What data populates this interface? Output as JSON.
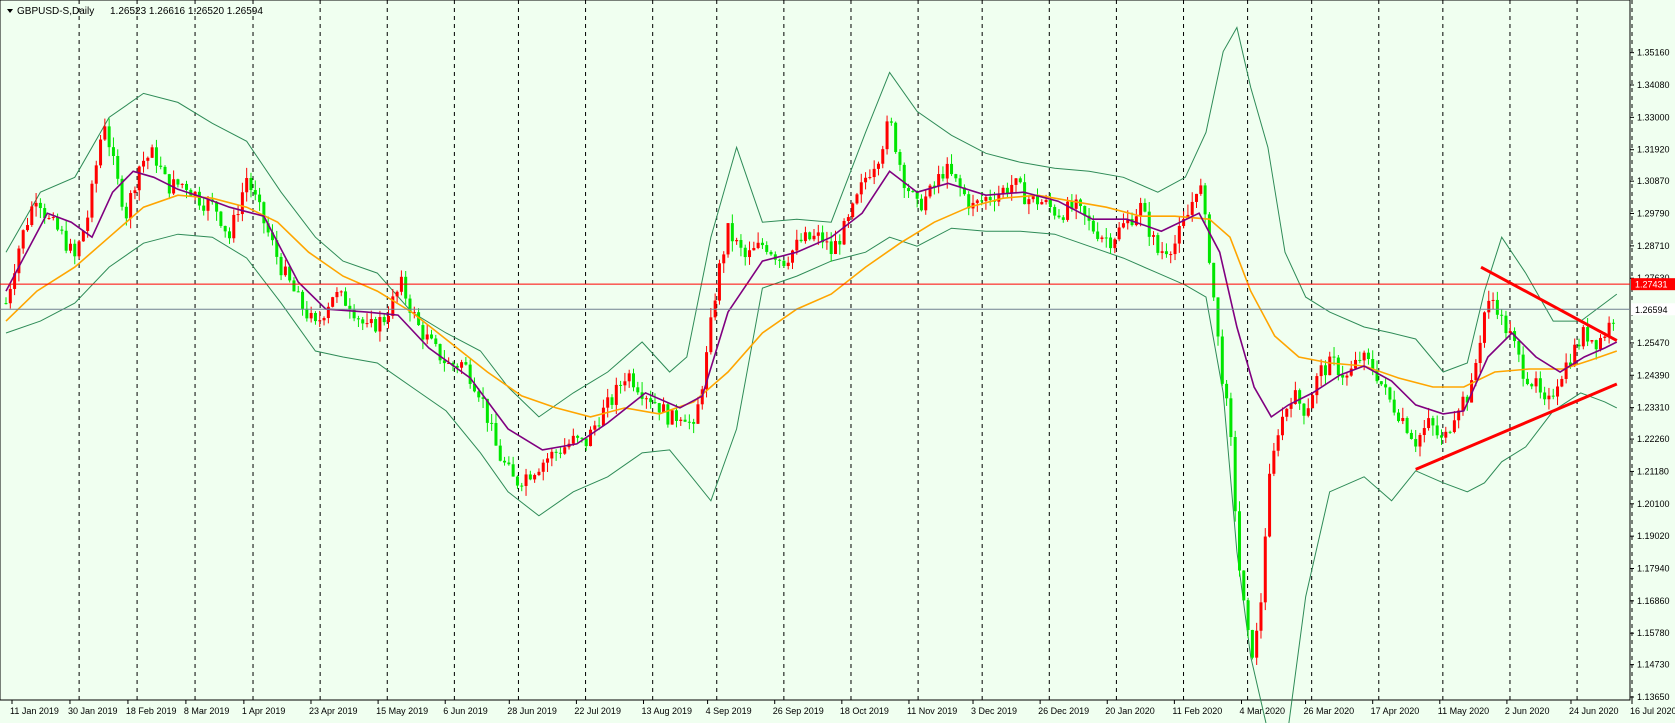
{
  "header": {
    "symbol": "GBPUSD-S,Daily",
    "ohlc": "1.26523 1.26616 1.26520 1.26594"
  },
  "colors": {
    "background": "#f0fff0",
    "bull": "#ff0000",
    "bear": "#00e600",
    "bollinger": "#2e8b57",
    "ma_fast": "#800080",
    "ma_slow": "#ffa500",
    "resistance_line": "#ff0000",
    "price_line": "#708090",
    "trendline": "#ff0000"
  },
  "chart_data": {
    "type": "candlestick",
    "ylim": [
      1.1365,
      1.3625
    ],
    "y_ticks": [
      "1.35160",
      "1.34080",
      "1.33000",
      "1.31920",
      "1.30870",
      "1.29790",
      "1.28710",
      "1.27630",
      "1.25470",
      "1.24390",
      "1.23310",
      "1.22260",
      "1.21180",
      "1.20100",
      "1.19020",
      "1.17940",
      "1.16860",
      "1.15780",
      "1.14730",
      "1.13650"
    ],
    "x_labels": [
      "11 Jan 2019",
      "30 Jan 2019",
      "18 Feb 2019",
      "8 Mar 2019",
      "1 Apr 2019",
      "23 Apr 2019",
      "15 May 2019",
      "6 Jun 2019",
      "28 Jun 2019",
      "22 Jul 2019",
      "13 Aug 2019",
      "4 Sep 2019",
      "26 Sep 2019",
      "18 Oct 2019",
      "11 Nov 2019",
      "3 Dec 2019",
      "26 Dec 2019",
      "20 Jan 2020",
      "11 Feb 2020",
      "4 Mar 2020",
      "26 Mar 2020",
      "17 Apr 2020",
      "11 May 2020",
      "2 Jun 2020",
      "24 Jun 2020",
      "16 Jul 2020"
    ],
    "horizontal_line": {
      "value": 1.27431,
      "label": "1.27431"
    },
    "current_price": {
      "value": 1.26594,
      "label": "1.26594"
    },
    "close_path": [
      [
        0,
        1.268
      ],
      [
        8,
        1.288
      ],
      [
        18,
        1.305
      ],
      [
        24,
        1.296
      ],
      [
        32,
        1.291
      ],
      [
        40,
        1.283
      ],
      [
        48,
        1.298
      ],
      [
        57,
        1.33
      ],
      [
        64,
        1.31
      ],
      [
        70,
        1.298
      ],
      [
        78,
        1.315
      ],
      [
        86,
        1.318
      ],
      [
        94,
        1.307
      ],
      [
        104,
        1.308
      ],
      [
        114,
        1.302
      ],
      [
        122,
        1.3
      ],
      [
        130,
        1.29
      ],
      [
        140,
        1.31
      ],
      [
        150,
        1.295
      ],
      [
        160,
        1.28
      ],
      [
        170,
        1.269
      ],
      [
        180,
        1.26
      ],
      [
        190,
        1.271
      ],
      [
        200,
        1.268
      ],
      [
        210,
        1.259
      ],
      [
        220,
        1.263
      ],
      [
        230,
        1.274
      ],
      [
        240,
        1.26
      ],
      [
        250,
        1.252
      ],
      [
        258,
        1.247
      ],
      [
        266,
        1.248
      ],
      [
        276,
        1.238
      ],
      [
        286,
        1.218
      ],
      [
        296,
        1.208
      ],
      [
        306,
        1.212
      ],
      [
        314,
        1.216
      ],
      [
        322,
        1.219
      ],
      [
        330,
        1.222
      ],
      [
        337,
        1.221
      ],
      [
        345,
        1.23
      ],
      [
        353,
        1.236
      ],
      [
        361,
        1.245
      ],
      [
        370,
        1.239
      ],
      [
        378,
        1.235
      ],
      [
        387,
        1.229
      ],
      [
        394,
        1.232
      ],
      [
        400,
        1.225
      ],
      [
        407,
        1.248
      ],
      [
        414,
        1.277
      ],
      [
        420,
        1.292
      ],
      [
        430,
        1.283
      ],
      [
        441,
        1.288
      ],
      [
        452,
        1.282
      ],
      [
        463,
        1.289
      ],
      [
        474,
        1.29
      ],
      [
        480,
        1.285
      ],
      [
        490,
        1.295
      ],
      [
        500,
        1.31
      ],
      [
        508,
        1.318
      ],
      [
        514,
        1.329
      ],
      [
        522,
        1.31
      ],
      [
        530,
        1.3
      ],
      [
        538,
        1.305
      ],
      [
        546,
        1.313
      ],
      [
        554,
        1.307
      ],
      [
        562,
        1.3
      ],
      [
        570,
        1.303
      ],
      [
        578,
        1.305
      ],
      [
        586,
        1.308
      ],
      [
        594,
        1.303
      ],
      [
        602,
        1.302
      ],
      [
        612,
        1.298
      ],
      [
        622,
        1.3
      ],
      [
        632,
        1.293
      ],
      [
        642,
        1.289
      ],
      [
        652,
        1.295
      ],
      [
        660,
        1.3
      ],
      [
        670,
        1.285
      ],
      [
        680,
        1.288
      ],
      [
        688,
        1.298
      ],
      [
        694,
        1.31
      ],
      [
        700,
        1.284
      ],
      [
        706,
        1.25
      ],
      [
        712,
        1.225
      ],
      [
        718,
        1.175
      ],
      [
        724,
        1.15
      ],
      [
        729,
        1.16
      ],
      [
        734,
        1.205
      ],
      [
        740,
        1.226
      ],
      [
        748,
        1.238
      ],
      [
        756,
        1.232
      ],
      [
        764,
        1.245
      ],
      [
        772,
        1.248
      ],
      [
        780,
        1.243
      ],
      [
        788,
        1.25
      ],
      [
        796,
        1.246
      ],
      [
        804,
        1.236
      ],
      [
        812,
        1.23
      ],
      [
        820,
        1.222
      ],
      [
        828,
        1.228
      ],
      [
        836,
        1.221
      ],
      [
        844,
        1.234
      ],
      [
        852,
        1.238
      ],
      [
        860,
        1.265
      ],
      [
        866,
        1.27
      ],
      [
        870,
        1.262
      ],
      [
        876,
        1.256
      ],
      [
        882,
        1.246
      ],
      [
        890,
        1.24
      ],
      [
        896,
        1.232
      ],
      [
        902,
        1.242
      ],
      [
        910,
        1.25
      ],
      [
        918,
        1.258
      ],
      [
        926,
        1.255
      ],
      [
        932,
        1.26
      ],
      [
        937,
        1.26594
      ]
    ],
    "ma_fast": [
      [
        0,
        1.272
      ],
      [
        12,
        1.285
      ],
      [
        24,
        1.298
      ],
      [
        38,
        1.295
      ],
      [
        50,
        1.29
      ],
      [
        62,
        1.305
      ],
      [
        74,
        1.312
      ],
      [
        86,
        1.31
      ],
      [
        100,
        1.306
      ],
      [
        116,
        1.303
      ],
      [
        130,
        1.3
      ],
      [
        150,
        1.297
      ],
      [
        170,
        1.275
      ],
      [
        186,
        1.266
      ],
      [
        210,
        1.265
      ],
      [
        228,
        1.264
      ],
      [
        246,
        1.253
      ],
      [
        270,
        1.243
      ],
      [
        292,
        1.226
      ],
      [
        312,
        1.219
      ],
      [
        332,
        1.221
      ],
      [
        350,
        1.228
      ],
      [
        372,
        1.238
      ],
      [
        392,
        1.233
      ],
      [
        405,
        1.237
      ],
      [
        420,
        1.265
      ],
      [
        440,
        1.282
      ],
      [
        460,
        1.285
      ],
      [
        480,
        1.29
      ],
      [
        498,
        1.298
      ],
      [
        514,
        1.312
      ],
      [
        530,
        1.305
      ],
      [
        548,
        1.308
      ],
      [
        570,
        1.304
      ],
      [
        592,
        1.305
      ],
      [
        612,
        1.302
      ],
      [
        632,
        1.296
      ],
      [
        652,
        1.296
      ],
      [
        672,
        1.292
      ],
      [
        694,
        1.298
      ],
      [
        706,
        1.285
      ],
      [
        716,
        1.26
      ],
      [
        726,
        1.24
      ],
      [
        736,
        1.23
      ],
      [
        746,
        1.234
      ],
      [
        760,
        1.238
      ],
      [
        776,
        1.244
      ],
      [
        790,
        1.247
      ],
      [
        806,
        1.242
      ],
      [
        820,
        1.234
      ],
      [
        836,
        1.231
      ],
      [
        848,
        1.232
      ],
      [
        862,
        1.25
      ],
      [
        876,
        1.258
      ],
      [
        890,
        1.25
      ],
      [
        904,
        1.245
      ],
      [
        918,
        1.25
      ],
      [
        930,
        1.253
      ],
      [
        937,
        1.255
      ]
    ],
    "ma_slow": [
      [
        0,
        1.262
      ],
      [
        18,
        1.272
      ],
      [
        40,
        1.28
      ],
      [
        60,
        1.29
      ],
      [
        80,
        1.3
      ],
      [
        100,
        1.304
      ],
      [
        120,
        1.303
      ],
      [
        140,
        1.3
      ],
      [
        158,
        1.295
      ],
      [
        176,
        1.285
      ],
      [
        196,
        1.277
      ],
      [
        216,
        1.272
      ],
      [
        236,
        1.265
      ],
      [
        258,
        1.255
      ],
      [
        280,
        1.245
      ],
      [
        300,
        1.237
      ],
      [
        320,
        1.233
      ],
      [
        340,
        1.23
      ],
      [
        360,
        1.233
      ],
      [
        380,
        1.231
      ],
      [
        400,
        1.235
      ],
      [
        420,
        1.245
      ],
      [
        440,
        1.258
      ],
      [
        460,
        1.266
      ],
      [
        480,
        1.271
      ],
      [
        500,
        1.28
      ],
      [
        520,
        1.288
      ],
      [
        540,
        1.295
      ],
      [
        560,
        1.3
      ],
      [
        580,
        1.303
      ],
      [
        600,
        1.304
      ],
      [
        620,
        1.302
      ],
      [
        640,
        1.3
      ],
      [
        660,
        1.297
      ],
      [
        680,
        1.297
      ],
      [
        700,
        1.296
      ],
      [
        712,
        1.29
      ],
      [
        724,
        1.272
      ],
      [
        738,
        1.257
      ],
      [
        752,
        1.25
      ],
      [
        770,
        1.248
      ],
      [
        790,
        1.247
      ],
      [
        810,
        1.243
      ],
      [
        830,
        1.24
      ],
      [
        848,
        1.24
      ],
      [
        866,
        1.245
      ],
      [
        886,
        1.246
      ],
      [
        906,
        1.246
      ],
      [
        922,
        1.249
      ],
      [
        937,
        1.252
      ]
    ],
    "bollinger_upper": [
      [
        0,
        1.285
      ],
      [
        20,
        1.305
      ],
      [
        40,
        1.31
      ],
      [
        60,
        1.33
      ],
      [
        80,
        1.338
      ],
      [
        100,
        1.335
      ],
      [
        120,
        1.328
      ],
      [
        140,
        1.322
      ],
      [
        160,
        1.305
      ],
      [
        180,
        1.29
      ],
      [
        196,
        1.282
      ],
      [
        216,
        1.278
      ],
      [
        236,
        1.265
      ],
      [
        256,
        1.258
      ],
      [
        276,
        1.252
      ],
      [
        292,
        1.24
      ],
      [
        310,
        1.23
      ],
      [
        330,
        1.238
      ],
      [
        350,
        1.245
      ],
      [
        370,
        1.255
      ],
      [
        386,
        1.245
      ],
      [
        396,
        1.25
      ],
      [
        410,
        1.29
      ],
      [
        425,
        1.32
      ],
      [
        440,
        1.295
      ],
      [
        460,
        1.296
      ],
      [
        480,
        1.295
      ],
      [
        500,
        1.325
      ],
      [
        514,
        1.345
      ],
      [
        530,
        1.332
      ],
      [
        550,
        1.324
      ],
      [
        570,
        1.318
      ],
      [
        590,
        1.315
      ],
      [
        610,
        1.313
      ],
      [
        630,
        1.312
      ],
      [
        650,
        1.31
      ],
      [
        670,
        1.305
      ],
      [
        686,
        1.31
      ],
      [
        698,
        1.325
      ],
      [
        708,
        1.352
      ],
      [
        716,
        1.36
      ],
      [
        724,
        1.34
      ],
      [
        734,
        1.32
      ],
      [
        744,
        1.285
      ],
      [
        756,
        1.27
      ],
      [
        770,
        1.265
      ],
      [
        790,
        1.26
      ],
      [
        806,
        1.258
      ],
      [
        820,
        1.256
      ],
      [
        836,
        1.245
      ],
      [
        850,
        1.248
      ],
      [
        860,
        1.272
      ],
      [
        870,
        1.29
      ],
      [
        884,
        1.278
      ],
      [
        900,
        1.262
      ],
      [
        916,
        1.262
      ],
      [
        930,
        1.268
      ],
      [
        937,
        1.271
      ]
    ],
    "bollinger_lower": [
      [
        0,
        1.258
      ],
      [
        20,
        1.262
      ],
      [
        40,
        1.268
      ],
      [
        60,
        1.28
      ],
      [
        80,
        1.288
      ],
      [
        100,
        1.291
      ],
      [
        120,
        1.29
      ],
      [
        140,
        1.283
      ],
      [
        160,
        1.268
      ],
      [
        180,
        1.252
      ],
      [
        196,
        1.25
      ],
      [
        216,
        1.248
      ],
      [
        236,
        1.24
      ],
      [
        256,
        1.232
      ],
      [
        276,
        1.218
      ],
      [
        292,
        1.205
      ],
      [
        310,
        1.197
      ],
      [
        330,
        1.205
      ],
      [
        350,
        1.21
      ],
      [
        370,
        1.218
      ],
      [
        386,
        1.219
      ],
      [
        396,
        1.212
      ],
      [
        410,
        1.202
      ],
      [
        425,
        1.226
      ],
      [
        440,
        1.273
      ],
      [
        460,
        1.277
      ],
      [
        480,
        1.282
      ],
      [
        500,
        1.285
      ],
      [
        514,
        1.29
      ],
      [
        530,
        1.287
      ],
      [
        550,
        1.293
      ],
      [
        570,
        1.292
      ],
      [
        590,
        1.292
      ],
      [
        610,
        1.291
      ],
      [
        630,
        1.287
      ],
      [
        650,
        1.283
      ],
      [
        670,
        1.278
      ],
      [
        686,
        1.274
      ],
      [
        698,
        1.27
      ],
      [
        708,
        1.238
      ],
      [
        716,
        1.185
      ],
      [
        724,
        1.15
      ],
      [
        734,
        1.125
      ],
      [
        744,
        1.118
      ],
      [
        756,
        1.17
      ],
      [
        770,
        1.205
      ],
      [
        790,
        1.21
      ],
      [
        806,
        1.202
      ],
      [
        820,
        1.212
      ],
      [
        836,
        1.208
      ],
      [
        850,
        1.205
      ],
      [
        860,
        1.208
      ],
      [
        870,
        1.215
      ],
      [
        884,
        1.22
      ],
      [
        900,
        1.232
      ],
      [
        916,
        1.238
      ],
      [
        930,
        1.235
      ],
      [
        937,
        1.233
      ]
    ],
    "trendlines": [
      {
        "name": "upper-trendline",
        "from": [
          858,
          1.28
        ],
        "to": [
          937,
          1.2555
        ]
      },
      {
        "name": "lower-trendline",
        "from": [
          820,
          1.2125
        ],
        "to": [
          937,
          1.241
        ]
      }
    ],
    "x_label_positions": [
      0,
      38,
      76,
      114,
      152,
      196,
      240,
      284,
      326,
      370,
      414,
      456,
      500,
      544,
      588,
      630,
      674,
      718,
      762,
      806,
      848,
      892,
      936,
      980,
      1022,
      1062
    ],
    "vertical_grid_positions": [
      44,
      82,
      120,
      158,
      202,
      246,
      290,
      332,
      376,
      420,
      462,
      506,
      550,
      594,
      636,
      680,
      724,
      768,
      810,
      852,
      896,
      938,
      982,
      1026,
      1062
    ]
  }
}
